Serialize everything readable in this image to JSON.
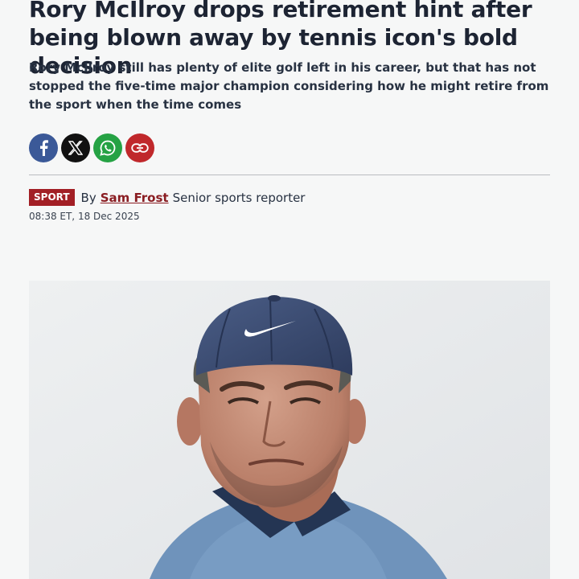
{
  "article": {
    "headline": "Rory McIlroy drops retirement hint after being blown away by tennis icon's bold decision",
    "standfirst": "Rory McIlroy still has plenty of elite golf left in his career, but that has not stopped the five-time major champion considering how he might retire from the sport when the time comes",
    "section": "SPORT",
    "by_prefix": "By",
    "author": "Sam Frost",
    "author_role": "Senior sports reporter",
    "timestamp": "08:38 ET, 18 Dec 2025"
  },
  "share": [
    {
      "network": "facebook",
      "icon": "facebook-icon",
      "color": "#3b5998"
    },
    {
      "network": "x",
      "icon": "x-icon",
      "color": "#111111"
    },
    {
      "network": "whatsapp",
      "icon": "whatsapp-icon",
      "color": "#25a244"
    },
    {
      "network": "copy-link",
      "icon": "link-icon",
      "color": "#c0282b"
    }
  ],
  "colors": {
    "section_tag": "#a21f25",
    "author_link": "#8a1d22",
    "background": "#f6f7f7"
  }
}
